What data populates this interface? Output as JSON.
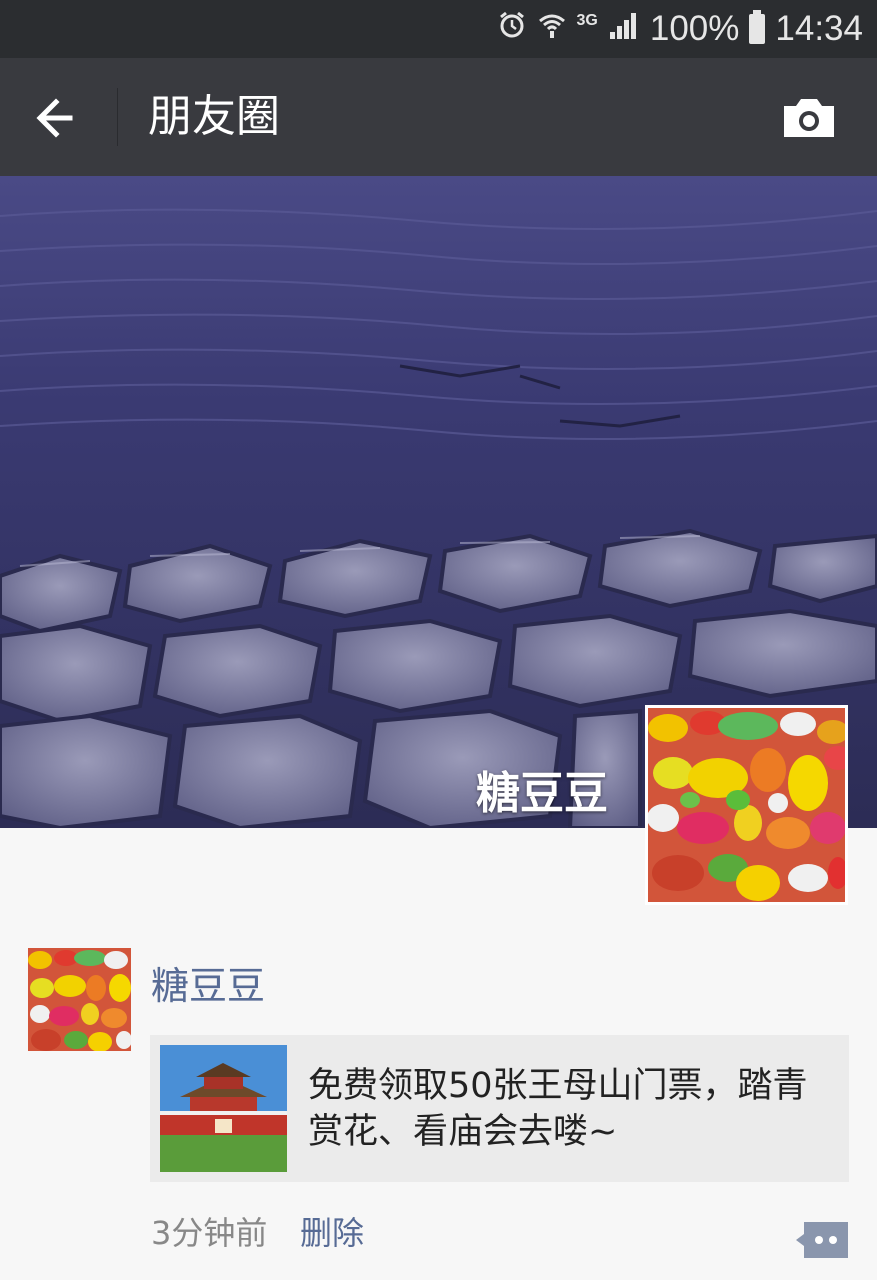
{
  "status_bar": {
    "network": "3G",
    "battery": "100%",
    "time": "14:34",
    "icons": [
      "alarm-icon",
      "wifi-icon",
      "signal-icon",
      "battery-icon"
    ]
  },
  "header": {
    "title": "朋友圈",
    "back_icon": "arrow-left-icon",
    "camera_icon": "camera-icon"
  },
  "cover": {
    "username": "糖豆豆"
  },
  "post": {
    "author": "糖豆豆",
    "link_text": "免费领取50张王母山门票，踏青赏花、看庙会去喽~",
    "time": "3分钟前",
    "delete_label": "删除"
  },
  "colors": {
    "status_bar_bg": "#2b2d30",
    "title_bar_bg": "#393a3f",
    "name_link": "#576b95",
    "page_bg": "#f7f7f7",
    "card_bg": "#ebebeb"
  }
}
